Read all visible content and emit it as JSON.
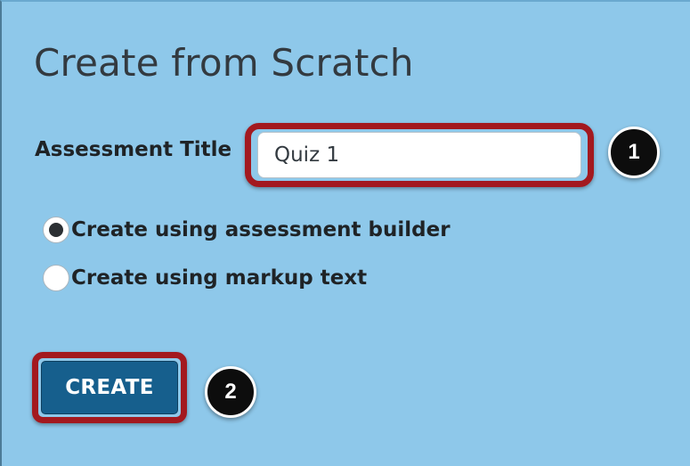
{
  "page": {
    "title": "Create from Scratch"
  },
  "form": {
    "assessment_title_label": "Assessment Title",
    "assessment_title_value": "Quiz 1",
    "options": [
      {
        "label": "Create using assessment builder",
        "selected": true
      },
      {
        "label": "Create using markup text",
        "selected": false
      }
    ],
    "create_button_label": "CREATE"
  },
  "callouts": {
    "step1": "1",
    "step2": "2"
  },
  "colors": {
    "panel_background": "#8ec8ea",
    "callout_border": "#a3191f",
    "button_background": "#165f8d",
    "badge_background": "#0d0d0d"
  }
}
